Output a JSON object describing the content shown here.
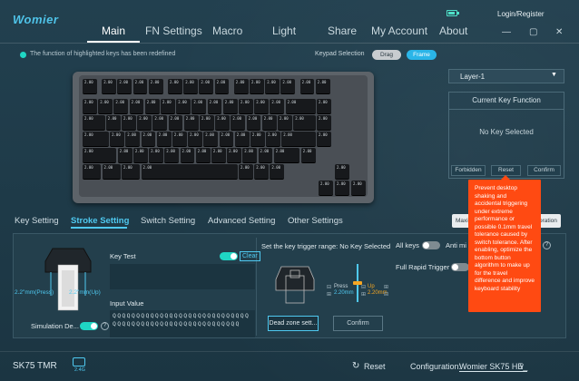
{
  "app": {
    "logo": "Womier"
  },
  "header": {
    "login": "Login/Register",
    "nav": [
      "Main",
      "FN Settings",
      "Macro",
      "Light",
      "Share",
      "My Account",
      "About"
    ],
    "active_nav": "Main"
  },
  "info": {
    "message": "The function of highlighted keys has been redefined"
  },
  "keypad": {
    "label": "Keypad Selection",
    "drag": "Drag",
    "frame": "Frame"
  },
  "right_panel": {
    "layer": "Layer-1",
    "title": "Current Key Function",
    "no_key": "No Key Selected",
    "forbidden": "Forbidden",
    "reset": "Reset",
    "confirm": "Confirm"
  },
  "tooltip": {
    "text": "Prevent desktop shaking and accidental triggering under extreme performance or possible 0.1mm travel tolerance caused by switch tolerance. After enabling, optimize the bottom button algorithm to make up for the travel difference and improve keyboard stability"
  },
  "tabs": [
    "Key Setting",
    "Stroke Setting",
    "Switch Setting",
    "Advanced Setting",
    "Other Settings"
  ],
  "active_tab": "Stroke Setting",
  "top_buttons": {
    "maxi": "Maxi",
    "oration": "oration"
  },
  "stroke": {
    "press_travel": "2.2\"mm(Press)",
    "up_travel": "2.2\"mm(Up)",
    "simulation": "Simulation De...",
    "key_test": "Key Test",
    "clear": "Clear",
    "input_value_label": "Input Value",
    "input_value": "QQQQQQQQQQQQQQQQQQQQQQQQQQQQQQQQQQQQQQQQQQQQQQQQQQQQQQQQ",
    "trigger_label": "Set the key trigger range: No Key Selected",
    "press_label": "Press",
    "press_value": "2.20mm",
    "up_label": "Up",
    "up_value": "2.20mm",
    "dead_zone": "Dead zone sett...",
    "confirm": "Confirm",
    "all_keys": "All keys",
    "anti": "Anti mi",
    "rapid": "Full Rapid Trigger"
  },
  "footer": {
    "model": "SK75 TMR",
    "dongle": "2.4G",
    "reset": "Reset",
    "config_label": "Configuration:",
    "config_value": "Womier SK75 HE_"
  },
  "key_legend": "2.00"
}
